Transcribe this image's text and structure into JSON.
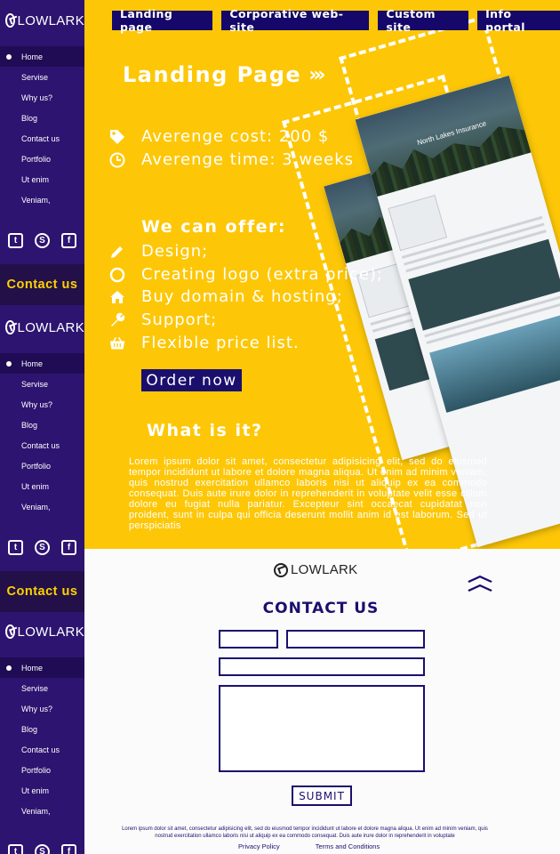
{
  "brand": {
    "name": "LOWLARK"
  },
  "sidebar": {
    "items": [
      "Home",
      "Servise",
      "Why us?",
      "Blog",
      "Contact us",
      "Portfolio",
      "Ut enim",
      "Veniam,"
    ],
    "active_item": "Home",
    "contact_label": "Contact us",
    "social": [
      {
        "icon": "twitter-icon",
        "glyph": "t"
      },
      {
        "icon": "skype-icon",
        "glyph": "S"
      },
      {
        "icon": "facebook-icon",
        "glyph": "f"
      }
    ]
  },
  "topnav": {
    "tabs": [
      "Landing page",
      "Corporative web-site",
      "Custom site",
      "Info portal"
    ]
  },
  "main": {
    "title": "Landing Page",
    "cost": "Averenge cost: 200 $",
    "time": "Averenge time: 3 weeks",
    "offer_title": "We can offer:",
    "offers": [
      {
        "icon": "pencil-icon",
        "label": "Design;"
      },
      {
        "icon": "circle-icon",
        "label": "Creating logo (extra price);"
      },
      {
        "icon": "home-icon",
        "label": "Buy domain & hosting;"
      },
      {
        "icon": "wrench-icon",
        "label": "Support;"
      },
      {
        "icon": "basket-icon",
        "label": "Flexible price list."
      }
    ],
    "order_label": "Order now",
    "what_title": "What is it?",
    "lorem": "Lorem ipsum dolor sit amet, consectetur adipisicing elit, sed do eiusmod tempor incididunt ut labore et dolore magna aliqua. Ut enim ad minim veniam, quis nostrud exercitation ullamco laboris nisi ut aliquip ex ea commodo consequat. Duis aute irure dolor in reprehenderit in voluptate velit esse cillum dolore eu fugiat nulla pariatur. Excepteur sint occaecat cupidatat non proident, sunt in culpa qui officia deserunt mollit anim id est laborum. Sed ut perspiciatis",
    "mockup_title": "North Lakes Insurance"
  },
  "footer": {
    "contact_title": "CONTACT US",
    "submit_label": "SUBMIT",
    "lorem": "Lorem ipsum dolor sit amet, consectetur adipisicing elit, sed do eiusmod tempor incididunt ut labore et dolore magna aliqua. Ut enim ad minim veniam, quis nostrud exercitation ullamco laboris nisi ut aliquip ex ea commodo consequat. Duis aute irure dolor in reprehenderit in voluptate",
    "privacy": "Privacy Policy",
    "terms": "Terms and Conditions"
  },
  "colors": {
    "accent_yellow": "#fdc707",
    "navy": "#1b0f6e",
    "sidebar": "#2d1470",
    "contact_yellow": "#ffd200"
  }
}
